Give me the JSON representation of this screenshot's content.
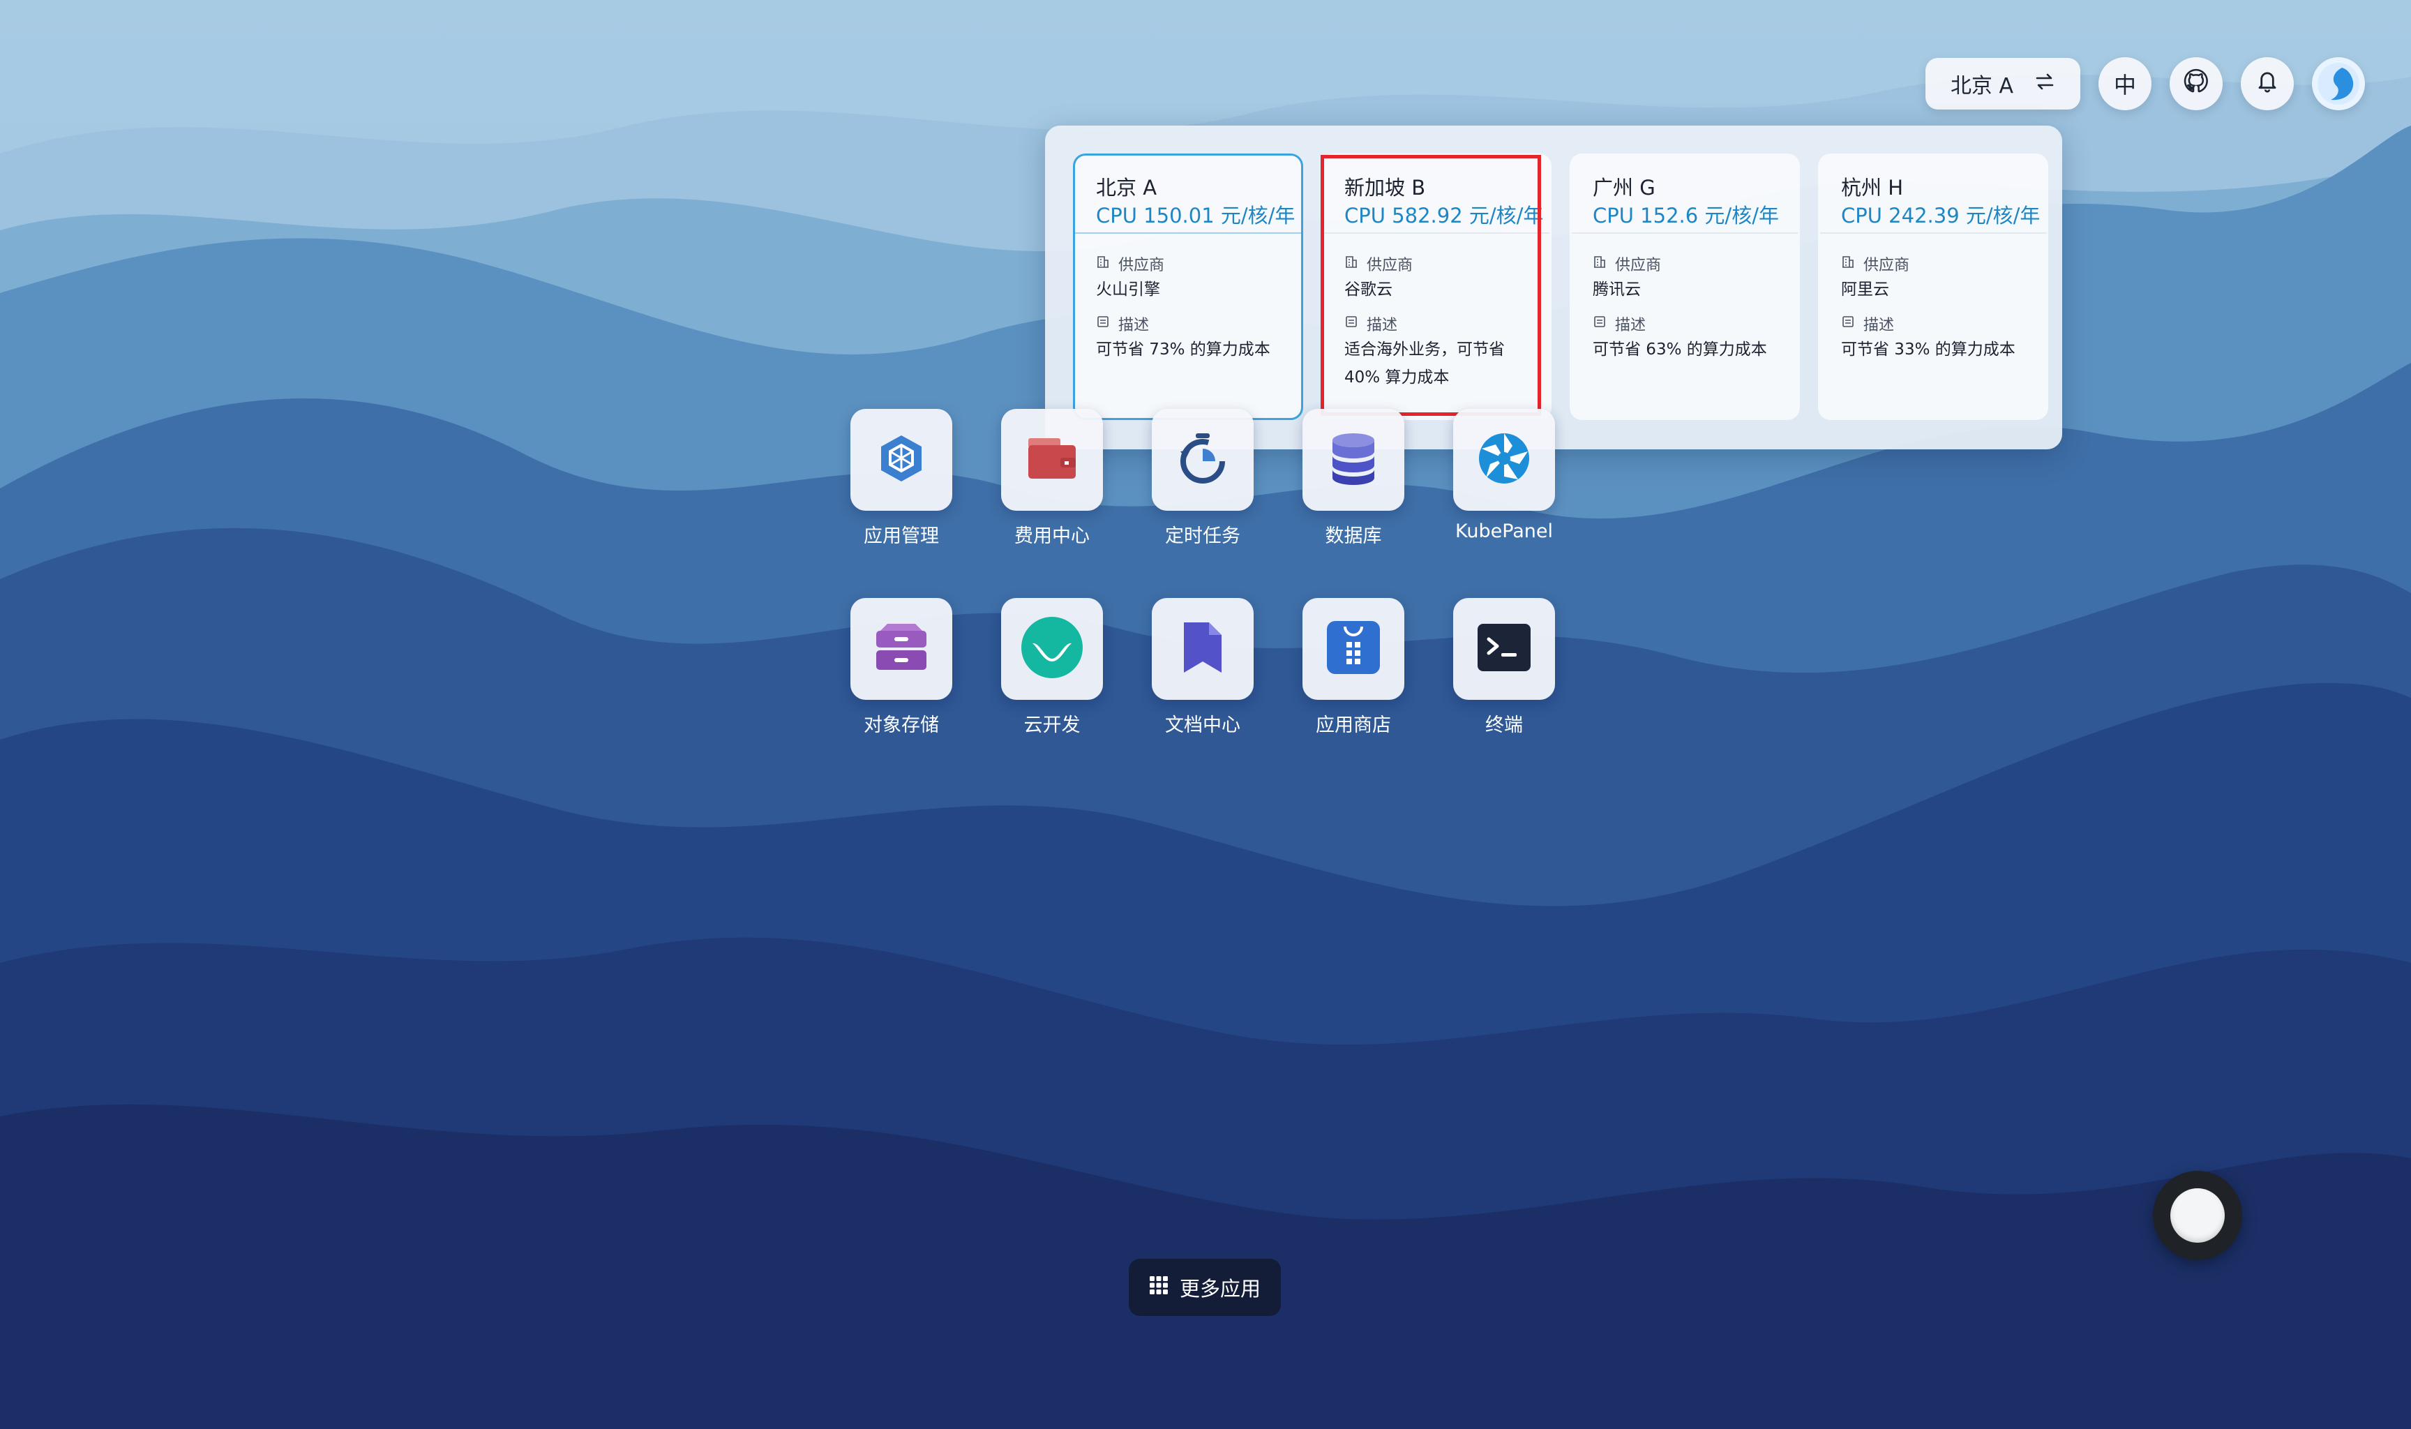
{
  "topbar": {
    "region_label": "北京 A",
    "language_label": "中",
    "switch_icon": "swap-icon",
    "github_icon": "github-icon",
    "bell_icon": "bell-icon"
  },
  "regions": [
    {
      "name": "北京 A",
      "price": "CPU 150.01 元/核/年",
      "provider_label": "供应商",
      "provider": "火山引擎",
      "desc_label": "描述",
      "desc": "可节省 73% 的算力成本"
    },
    {
      "name": "新加坡 B",
      "price": "CPU 582.92 元/核/年",
      "provider_label": "供应商",
      "provider": "谷歌云",
      "desc_label": "描述",
      "desc": "适合海外业务，可节省 40% 算力成本"
    },
    {
      "name": "广州 G",
      "price": "CPU 152.6 元/核/年",
      "provider_label": "供应商",
      "provider": "腾讯云",
      "desc_label": "描述",
      "desc": "可节省 63% 的算力成本"
    },
    {
      "name": "杭州 H",
      "price": "CPU 242.39 元/核/年",
      "provider_label": "供应商",
      "provider": "阿里云",
      "desc_label": "描述",
      "desc": "可节省 33% 的算力成本"
    }
  ],
  "apps": [
    {
      "label": "应用管理",
      "icon": "hexagon-icon"
    },
    {
      "label": "费用中心",
      "icon": "wallet-icon"
    },
    {
      "label": "定时任务",
      "icon": "timer-icon"
    },
    {
      "label": "数据库",
      "icon": "database-icon"
    },
    {
      "label": "KubePanel",
      "icon": "aperture-icon"
    },
    {
      "label": "对象存储",
      "icon": "storage-icon"
    },
    {
      "label": "云开发",
      "icon": "cloud-dev-icon"
    },
    {
      "label": "文档中心",
      "icon": "document-icon"
    },
    {
      "label": "应用商店",
      "icon": "store-icon"
    },
    {
      "label": "终端",
      "icon": "terminal-icon"
    }
  ],
  "more_apps_label": "更多应用",
  "colors": {
    "accent": "#1f86c4",
    "highlight": "#e5252c",
    "active_border": "#3ba3dd"
  }
}
